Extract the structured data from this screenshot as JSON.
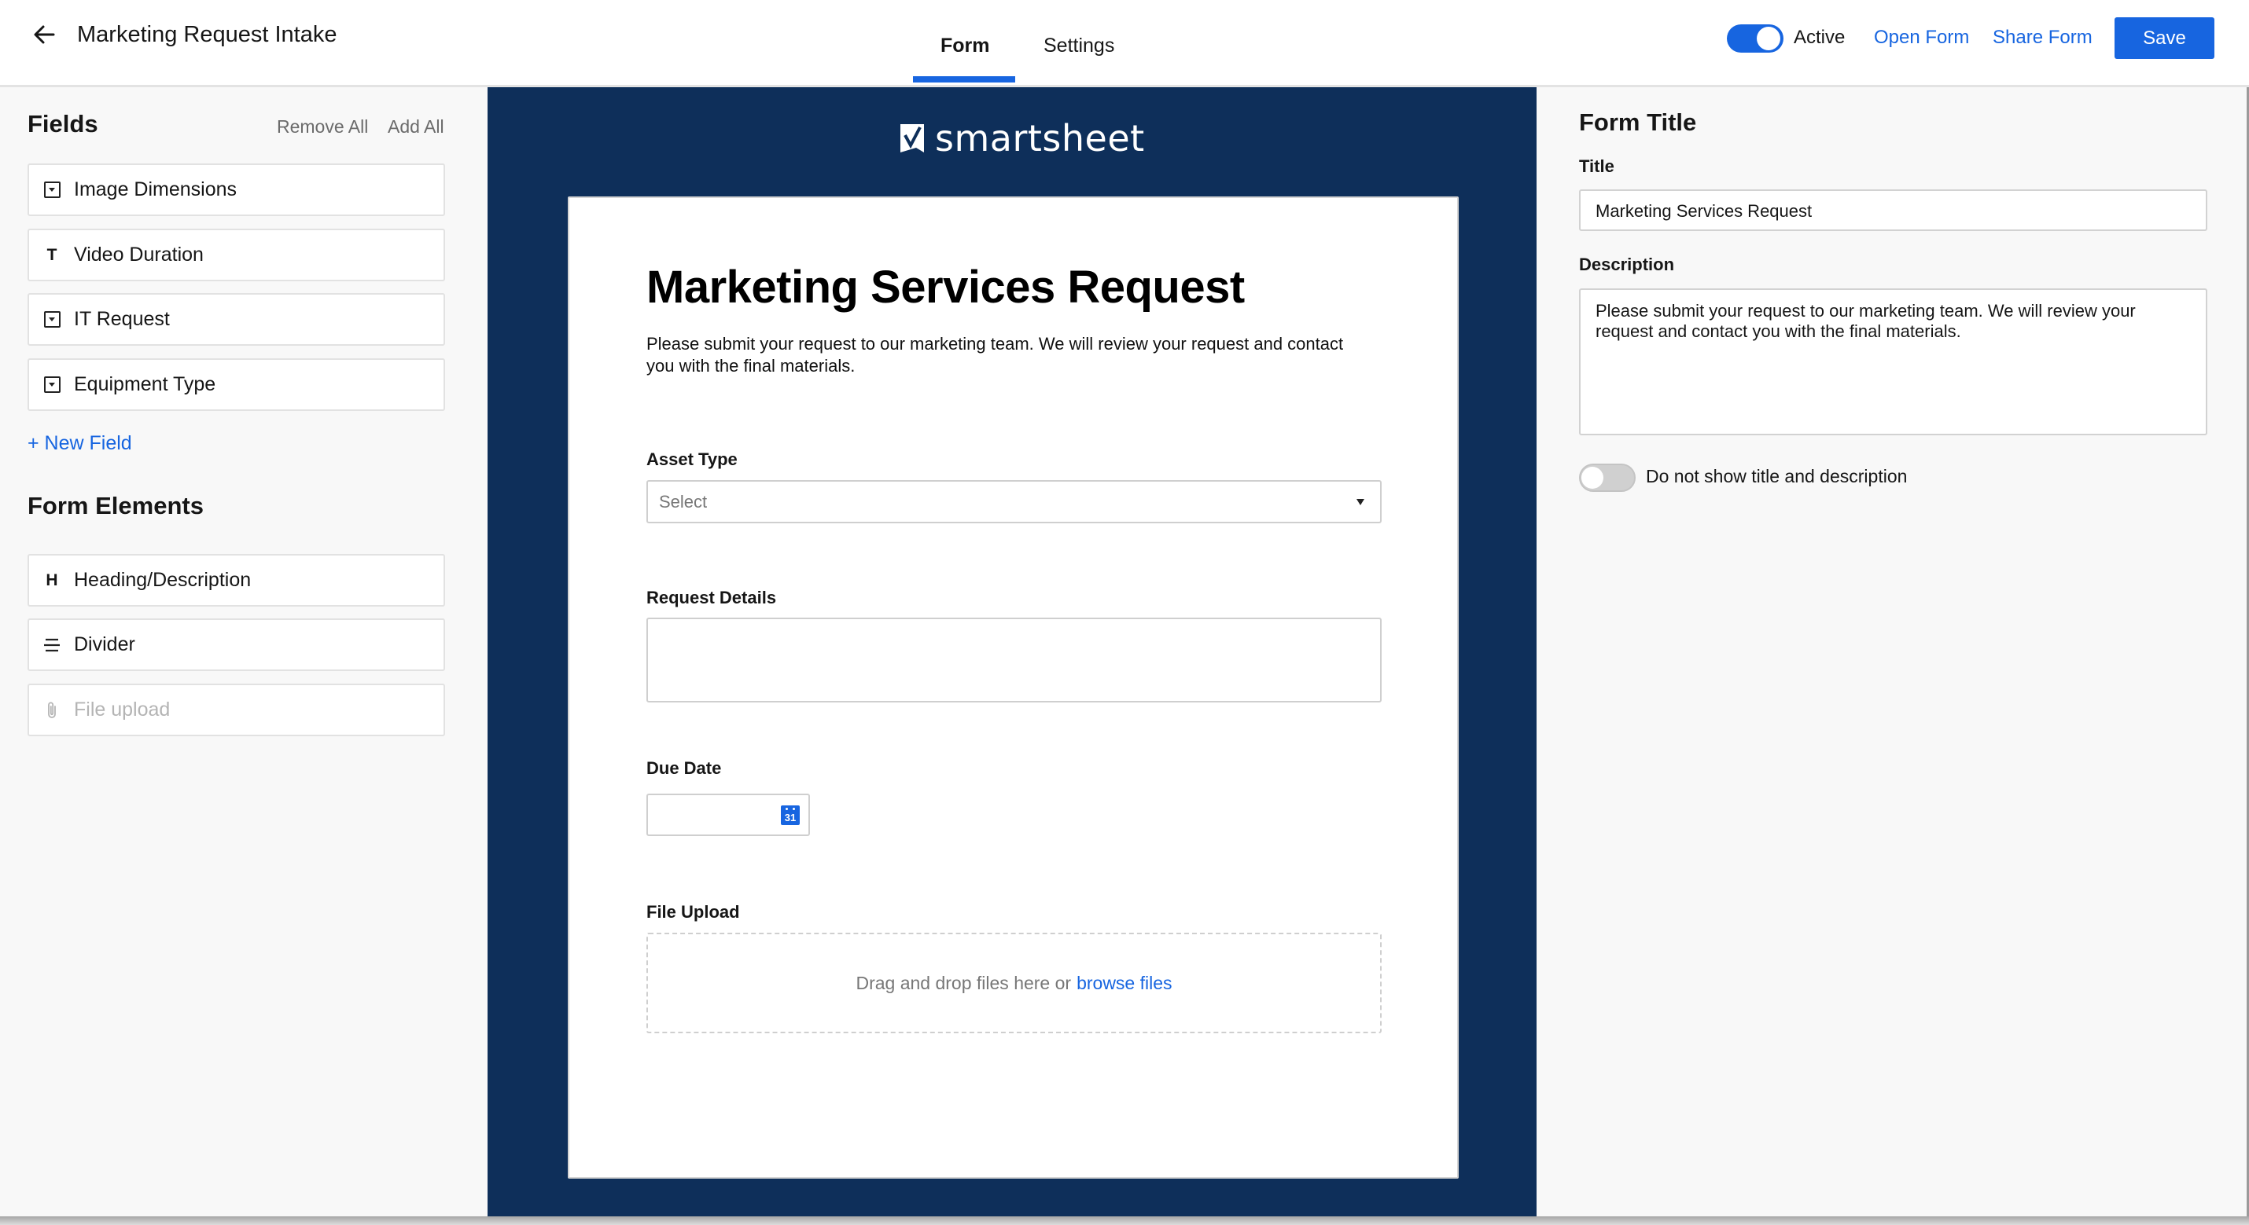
{
  "header": {
    "back_icon": "arrow-left-icon",
    "title": "Marketing Request Intake",
    "tabs": [
      {
        "label": "Form",
        "active": true
      },
      {
        "label": "Settings",
        "active": false
      }
    ],
    "active_toggle": {
      "label": "Active",
      "on": true
    },
    "open_form_label": "Open Form",
    "share_form_label": "Share Form",
    "save_label": "Save",
    "accent_color": "#1765e0"
  },
  "left_panel": {
    "fields_title": "Fields",
    "remove_all_label": "Remove All",
    "add_all_label": "Add All",
    "fields": [
      {
        "label": "Image Dimensions",
        "icon": "dropdown-field-icon"
      },
      {
        "label": "Video Duration",
        "icon": "text-field-icon",
        "glyph": "T"
      },
      {
        "label": "IT Request",
        "icon": "dropdown-field-icon"
      },
      {
        "label": "Equipment Type",
        "icon": "dropdown-field-icon"
      }
    ],
    "new_field_label": "+ New Field",
    "form_elements_title": "Form Elements",
    "form_elements": [
      {
        "label": "Heading/Description",
        "icon": "heading-icon",
        "glyph": "H",
        "disabled": false
      },
      {
        "label": "Divider",
        "icon": "divider-icon",
        "disabled": false
      },
      {
        "label": "File upload",
        "icon": "paperclip-icon",
        "disabled": true
      }
    ]
  },
  "preview": {
    "background_color": "#0e2f5a",
    "logo_text": "smartsheet",
    "form_title": "Marketing Services Request",
    "form_description": "Please submit your request to our marketing team. We will review your request and contact you with the final materials.",
    "questions": {
      "asset_type": {
        "label": "Asset Type",
        "placeholder": "Select"
      },
      "request_details": {
        "label": "Request Details",
        "value": ""
      },
      "due_date": {
        "label": "Due Date",
        "value": "",
        "calendar_day": "31"
      },
      "file_upload": {
        "label": "File Upload",
        "prompt": "Drag and drop files here or",
        "browse_label": "browse files"
      }
    }
  },
  "right_panel": {
    "section_title": "Form Title",
    "title_label": "Title",
    "title_value": "Marketing Services Request",
    "description_label": "Description",
    "description_value": "Please submit your request to our marketing team. We will review your request and contact you with the final materials.",
    "hide_toggle": {
      "label": "Do not show title and description",
      "on": false
    }
  }
}
